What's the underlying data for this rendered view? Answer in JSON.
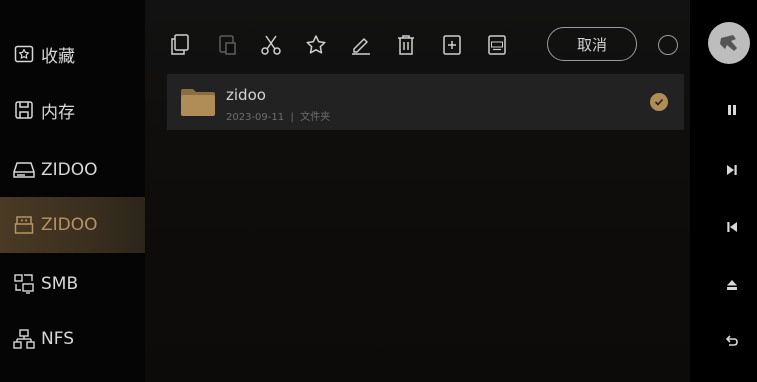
{
  "sidebar": {
    "items": [
      {
        "label": "收藏",
        "icon": "star-box-icon"
      },
      {
        "label": "内存",
        "icon": "save-icon"
      },
      {
        "label": "ZIDOO",
        "icon": "hard-drive-icon"
      },
      {
        "label": "ZIDOO",
        "icon": "usb-icon",
        "active": true
      },
      {
        "label": "SMB",
        "icon": "network-share-icon"
      },
      {
        "label": "NFS",
        "icon": "network-tree-icon"
      }
    ]
  },
  "toolbar": {
    "actions": [
      "copy-icon",
      "paste-icon",
      "cut-icon",
      "favorite-icon",
      "rename-icon",
      "delete-icon",
      "new-folder-icon",
      "ssd-icon"
    ],
    "cancel_label": "取消"
  },
  "files": [
    {
      "name": "zidoo",
      "date": "2023-09-11",
      "type": "文件夹",
      "selected": true
    }
  ],
  "playback": {
    "controls": [
      "pause-icon",
      "next-track-icon",
      "previous-track-icon",
      "eject-icon",
      "return-icon"
    ]
  },
  "colors": {
    "accent": "#b08d57",
    "active_bg": "#3b2f1f",
    "row_bg": "#222222"
  }
}
